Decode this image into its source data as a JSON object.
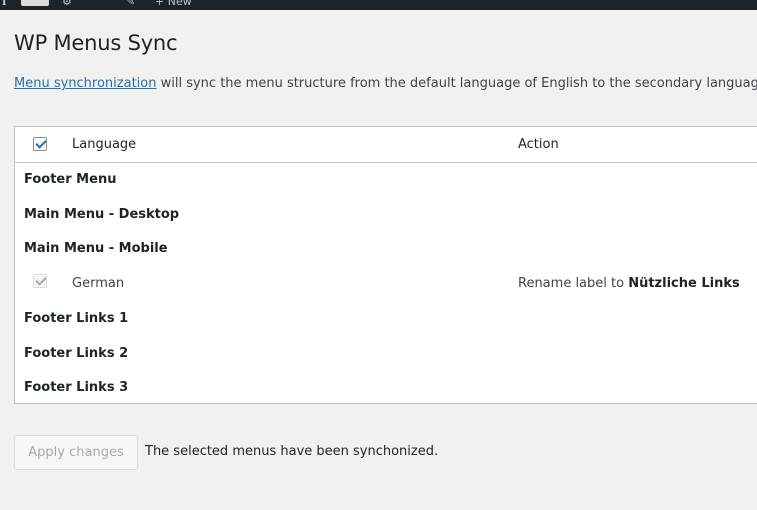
{
  "adminbar": {
    "new_label": "+ New",
    "frag_1": "ℹ",
    "frag_2": "⚙",
    "frag_3": "✎"
  },
  "page": {
    "title": "WP Menus Sync",
    "intro_link": "Menu synchronization",
    "intro_text": " will sync the menu structure from the default language of English to the secondary languages."
  },
  "table": {
    "col_language": "Language",
    "col_action": "Action",
    "header_checked": true,
    "menus": [
      "Footer Menu",
      "Main Menu - Desktop",
      "Main Menu - Mobile"
    ],
    "language_row": {
      "label": "German",
      "checked": true,
      "disabled": true,
      "action_prefix": "Rename label to ",
      "action_value": "Nützliche Links"
    },
    "menus_after": [
      "Footer Links 1",
      "Footer Links 2",
      "Footer Links 3"
    ]
  },
  "footer": {
    "apply_label": "Apply changes",
    "notice": "The selected menus have been synchonized."
  }
}
